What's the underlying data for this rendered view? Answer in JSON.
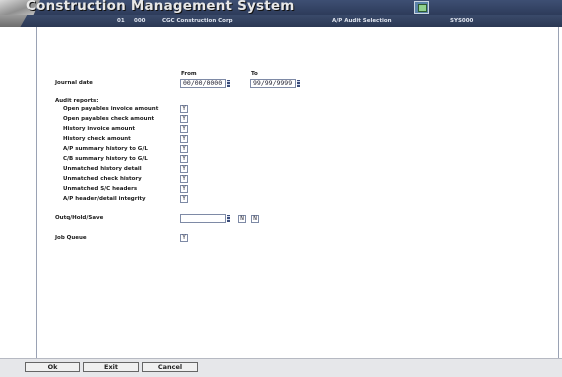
{
  "app": {
    "title": "Construction Management System",
    "company_no": "01",
    "division": "000",
    "company_name": "CGC Construction Corp",
    "screen_title": "A/P Audit Selection",
    "program_id": "SYS000"
  },
  "form": {
    "from_header": "From",
    "to_header": "To",
    "journal_date": {
      "label": "Journal date",
      "from": "00/00/0000",
      "to": "99/99/9999"
    },
    "audit_reports_label": "Audit reports:",
    "audit_reports": [
      {
        "label": "Open payables invoice amount",
        "value": "Y"
      },
      {
        "label": "Open payables check amount",
        "value": "Y"
      },
      {
        "label": "History invoice amount",
        "value": "Y"
      },
      {
        "label": "History check amount",
        "value": "Y"
      },
      {
        "label": "A/P summary history to G/L",
        "value": "Y"
      },
      {
        "label": "C/B summary history to G/L",
        "value": "Y"
      },
      {
        "label": "Unmatched history detail",
        "value": "Y"
      },
      {
        "label": "Unmatched check history",
        "value": "Y"
      },
      {
        "label": "Unmatched S/C headers",
        "value": "Y"
      },
      {
        "label": "A/P header/detail integrity",
        "value": "Y"
      }
    ],
    "outq": {
      "label": "Outq/Hold/Save",
      "value": "",
      "hold": "N",
      "save": "N"
    },
    "job_queue": {
      "label": "Job Queue",
      "value": "Y"
    }
  },
  "buttons": {
    "ok": "Ok",
    "exit": "Exit",
    "cancel": "Cancel"
  },
  "colors": {
    "titlebar": "#2d3b5a",
    "field_border": "#7e8aa6",
    "spinner": "#3b4d7a"
  },
  "icons": {
    "app_icon": "window-app-icon",
    "spinner": "spin-arrows-icon"
  }
}
